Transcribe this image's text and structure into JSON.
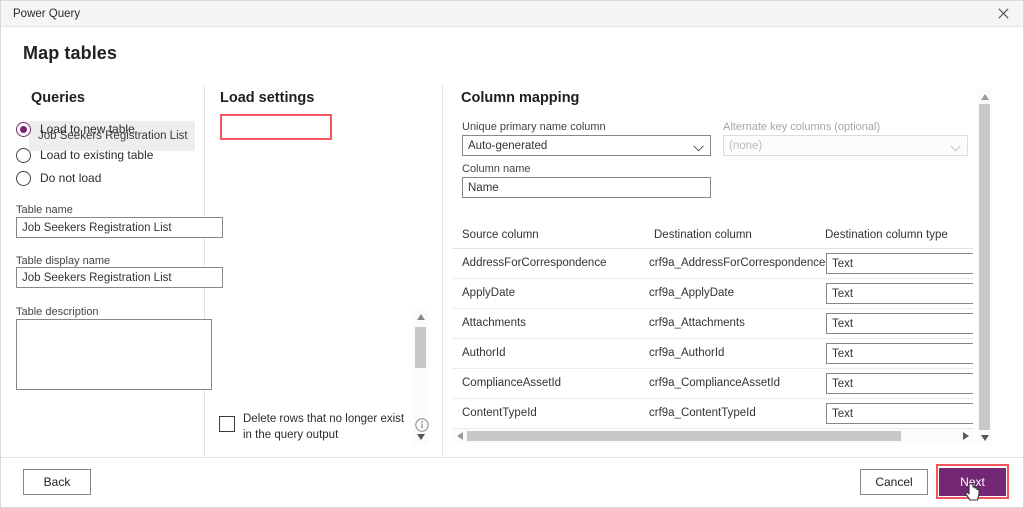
{
  "window": {
    "title": "Power Query",
    "close_icon": "close-icon"
  },
  "page": {
    "heading": "Map tables"
  },
  "queries": {
    "heading": "Queries",
    "items": [
      {
        "label": "Job Seekers Registration List"
      }
    ]
  },
  "load_settings": {
    "heading": "Load settings",
    "radios": [
      {
        "label": "Load to new table",
        "checked": true
      },
      {
        "label": "Load to existing table",
        "checked": false
      },
      {
        "label": "Do not load",
        "checked": false
      }
    ],
    "table_name": {
      "label": "Table name",
      "value": "Job Seekers Registration List"
    },
    "table_display_name": {
      "label": "Table display name",
      "value": "Job Seekers Registration List"
    },
    "table_description": {
      "label": "Table description",
      "value": ""
    },
    "delete_rows": {
      "label": "Delete rows that no longer exist in the query output",
      "checked": false,
      "info_icon": "info-icon"
    },
    "scrollbar": {
      "up_icon": "caret-up-icon",
      "down_icon": "caret-down-icon"
    }
  },
  "column_mapping": {
    "heading": "Column mapping",
    "unique_primary_name": {
      "label": "Unique primary name column",
      "value": "Auto-generated",
      "chevron_icon": "chevron-down-icon"
    },
    "alternate_key": {
      "label": "Alternate key columns (optional)",
      "value": "(none)",
      "disabled": true,
      "chevron_icon": "chevron-down-icon"
    },
    "column_name": {
      "label": "Column name",
      "value": "Name"
    },
    "table_headers": [
      "Source column",
      "Destination column",
      "Destination column type"
    ],
    "rows": [
      {
        "source": "AddressForCorrespondence",
        "destination": "crf9a_AddressForCorrespondence",
        "type": "Text"
      },
      {
        "source": "ApplyDate",
        "destination": "crf9a_ApplyDate",
        "type": "Text"
      },
      {
        "source": "Attachments",
        "destination": "crf9a_Attachments",
        "type": "Text"
      },
      {
        "source": "AuthorId",
        "destination": "crf9a_AuthorId",
        "type": "Text"
      },
      {
        "source": "ComplianceAssetId",
        "destination": "crf9a_ComplianceAssetId",
        "type": "Text"
      },
      {
        "source": "ContentTypeId",
        "destination": "crf9a_ContentTypeId",
        "type": "Text"
      }
    ],
    "h_scroll": {
      "left_icon": "caret-left-icon",
      "right_icon": "caret-right-icon"
    },
    "v_scroll": {
      "up_icon": "caret-up-icon",
      "down_icon": "caret-down-icon"
    }
  },
  "footer": {
    "back_label": "Back",
    "cancel_label": "Cancel",
    "next_label": "Next"
  },
  "colors": {
    "accent_purple": "#742774",
    "highlight_red": "#f3565d",
    "panel_grey": "#eeeeee",
    "scrollbar_thumb": "#c8c8c8"
  }
}
